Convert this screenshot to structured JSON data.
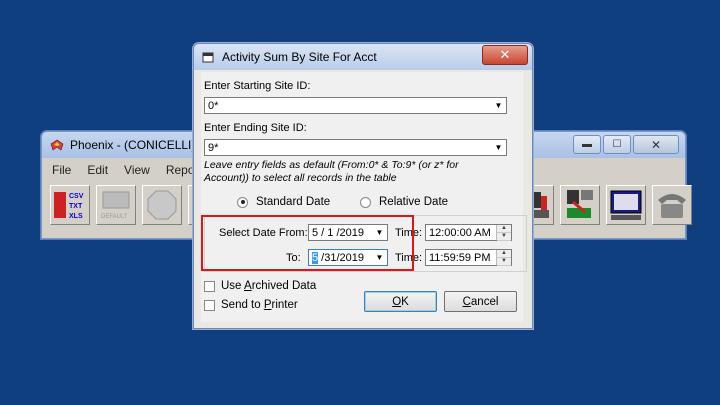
{
  "main_window": {
    "title": "Phoenix - (CONICELLI)",
    "menu": [
      "File",
      "Edit",
      "View",
      "Repor"
    ],
    "toolbar": {
      "export_button_text": [
        "CSV",
        "TXT",
        "XLS"
      ],
      "default_button_label": "DEFAULT"
    }
  },
  "dialog": {
    "title": "Activity Sum By Site For Acct",
    "close_glyph": "✕",
    "start_label": "Enter Starting Site ID:",
    "start_value": "0*",
    "end_label": "Enter Ending Site ID:",
    "end_value": "9*",
    "hint": "Leave entry fields as default (From:0* & To:9* (or z* for Account)) to select all records in the table",
    "radio_standard": "Standard Date",
    "radio_relative": "Relative Date",
    "date_from_label": "Select Date From:",
    "date_from_value": "5 / 1 /2019",
    "date_to_label": "To:",
    "date_to_selected": "5",
    "date_to_rest": " /31/2019",
    "time_label_1": "Time:",
    "time_from_value": "12:00:00 AM",
    "time_label_2": "Time:",
    "time_to_value": "11:59:59 PM",
    "archived_label_pre": "Use ",
    "archived_label_u": "A",
    "archived_label_post": "rchived Data",
    "printer_label_pre": "Send to ",
    "printer_label_u": "P",
    "printer_label_post": "rinter",
    "ok_u": "O",
    "ok_rest": "K",
    "cancel_u": "C",
    "cancel_rest": "ancel"
  },
  "colors": {
    "desktop": "#0f3f7e",
    "highlight": "#e01515"
  }
}
